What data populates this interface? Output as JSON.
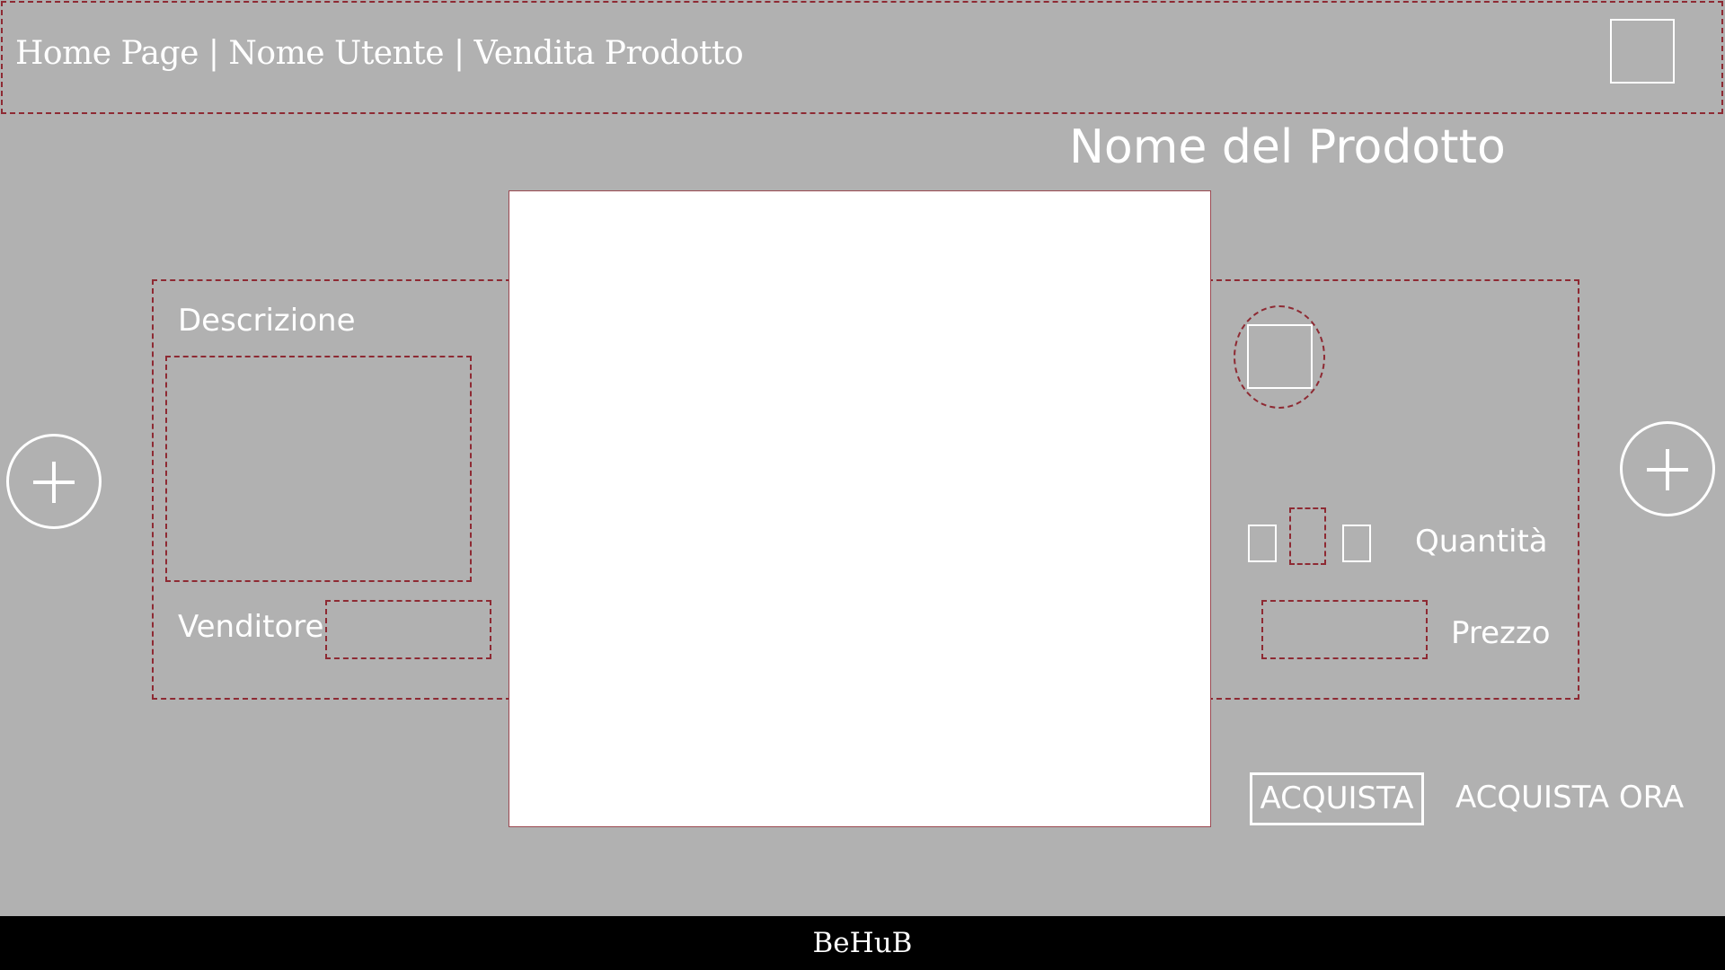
{
  "header": {
    "breadcrumb": {
      "home": "Home Page",
      "separator": "|",
      "user": "Nome Utente",
      "current": "Vendita Prodotto"
    }
  },
  "product": {
    "title": "Nome del Prodotto"
  },
  "left_panel": {
    "description_label": "Descrizione",
    "description_value": "",
    "seller_label": "Venditore",
    "seller_value": ""
  },
  "right_panel": {
    "quantity_label": "Quantità",
    "quantity_value": "",
    "price_label": "Prezzo",
    "price_value": ""
  },
  "actions": {
    "buy_label": "ACQUISTA",
    "buy_now_label": "ACQUISTA ORA"
  },
  "footer": {
    "brand": "BeHuB"
  },
  "icons": {
    "prev": "plus-circle-icon",
    "next": "plus-circle-icon"
  },
  "colors": {
    "background": "#b1b1b1",
    "dashed_border": "#8e2a33",
    "text": "#ffffff",
    "footer": "#000000"
  }
}
